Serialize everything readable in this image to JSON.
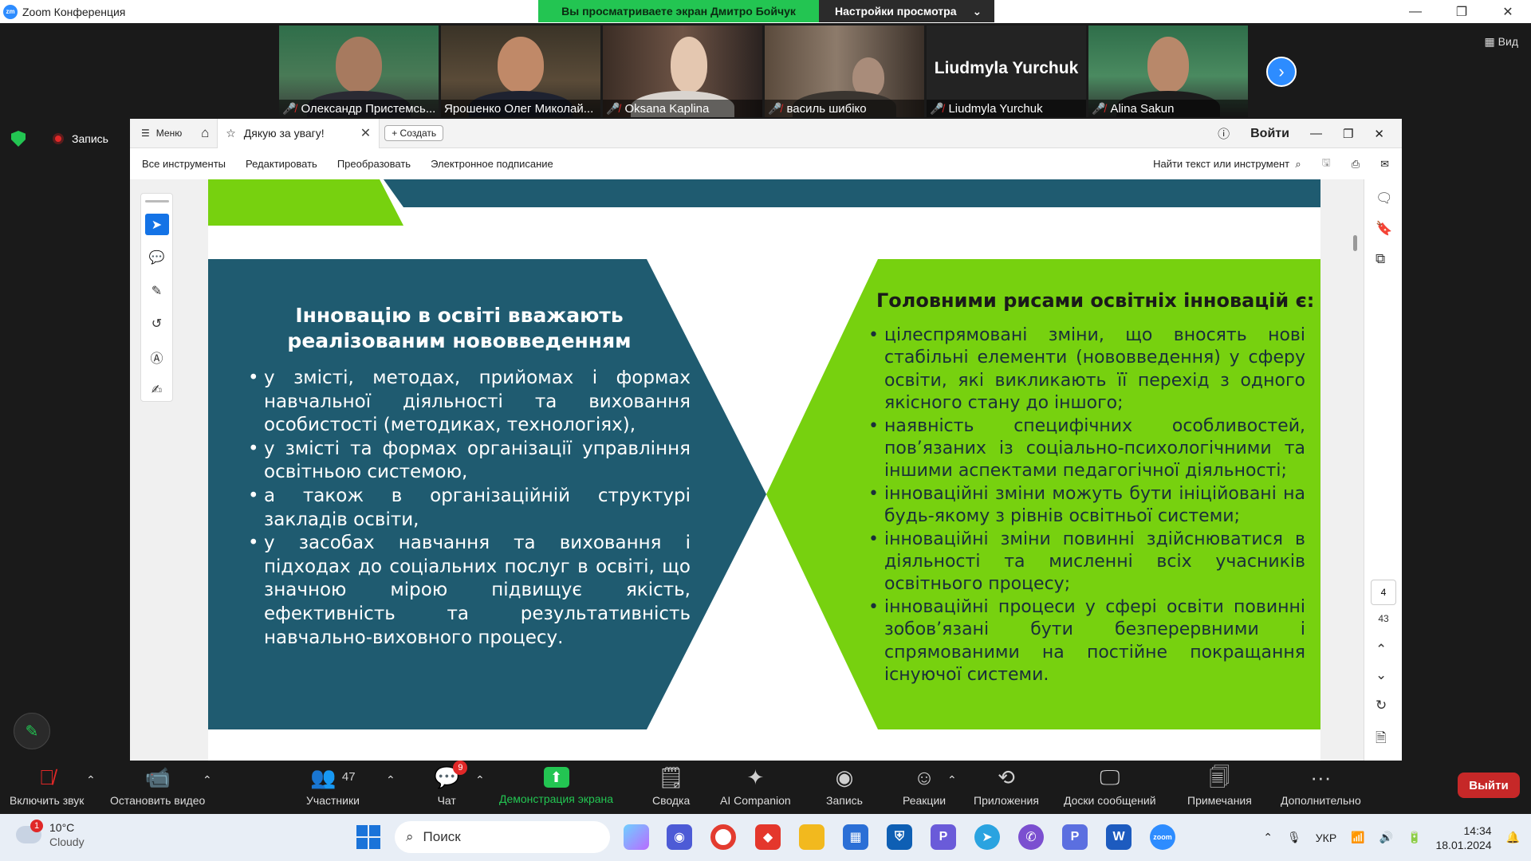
{
  "window": {
    "title": "Zoom Конференция",
    "share_notice": "Вы просматриваете экран Дмитро Бойчук",
    "view_settings": "Настройки просмотра",
    "view_button": "Вид",
    "recording_label": "Запись"
  },
  "participants": [
    {
      "name": "Олександр Пристемсь...",
      "active": false
    },
    {
      "name": "Ярошенко Олег Миколай...",
      "active": true
    },
    {
      "name": "Oksana Kaplina",
      "active": false
    },
    {
      "name": "василь шибіко",
      "active": false
    },
    {
      "name": "Liudmyla Yurchuk",
      "big_name": "Liudmyla Yurchuk",
      "active": false
    },
    {
      "name": "Alina Sakun",
      "active": false
    }
  ],
  "acrobat": {
    "menu_label": "Меню",
    "doc_tab": "Дякую за увагу!",
    "create_label": "Создать",
    "login_label": "Войти",
    "menu_items": [
      "Все инструменты",
      "Редактировать",
      "Преобразовать",
      "Электронное подписание"
    ],
    "find_label": "Найти текст или инструмент",
    "page_current": "4",
    "page_total": "43"
  },
  "slide": {
    "left_title": "Інновацію в освіті вважають реалізованим нововведенням",
    "left_items": [
      "у змісті, методах, прийомах і формах навчальної діяльності та виховання особистості (методиках, технологіях),",
      "у змісті та формах організації управління освітньою системою,",
      "а також в організаційній структурі закладів освіти,",
      "у засобах навчання та виховання і підходах до соціальних послуг в освіті, що значною мірою підвищує якість, ефективність та результативність навчально-виховного процесу."
    ],
    "right_title": "Головними рисами освітніх інновацій є:",
    "right_items": [
      "цілеспрямовані зміни, що вносять нові стабільні елементи (нововведення) у сферу освіти, які викликають її перехід з одного якісного стану до іншого;",
      "наявність специфічних особливостей, пов’язаних із соціально-психологічними та іншими аспектами педагогічної діяльності;",
      "інноваційні зміни можуть бути ініційовані на будь-якому з рівнів освітньої системи;",
      "інноваційні зміни повинні здійснюватися в діяльності та мисленні всіх учасників освітнього процесу;",
      "інноваційні процеси у сфері освіти повинні зобов’язані бути безперервними і спрямованими на постійне покращання існуючої системи."
    ],
    "colors": {
      "teal": "#1f5b70",
      "green": "#77d10f"
    }
  },
  "toolbar": {
    "unmute": "Включить звук",
    "stop_video": "Остановить видео",
    "participants": "Участники",
    "participants_count": "47",
    "chat": "Чат",
    "chat_badge": "9",
    "share": "Демонстрация экрана",
    "summary": "Сводка",
    "ai": "AI Companion",
    "record": "Запись",
    "reactions": "Реакции",
    "apps": "Приложения",
    "whiteboards": "Доски сообщений",
    "notes": "Примечания",
    "more": "Дополнительно",
    "leave": "Выйти"
  },
  "taskbar": {
    "temp": "10°C",
    "condition": "Cloudy",
    "weather_badge": "1",
    "search_placeholder": "Поиск",
    "lang": "УКР",
    "time": "14:34",
    "date": "18.01.2024"
  }
}
